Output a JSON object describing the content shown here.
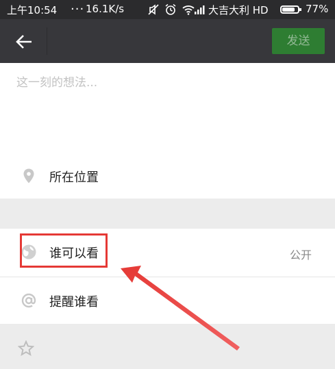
{
  "status_bar": {
    "time": "上午10:54",
    "dots": "...",
    "speed": "16.1K/s",
    "carrier": "大吉大利 HD",
    "battery": "77%",
    "icons": [
      "mute-icon",
      "alarm-icon",
      "wifi-icon",
      "signal-icon",
      "battery-icon"
    ]
  },
  "toolbar": {
    "back_icon": "arrow-left-icon",
    "send_label": "发送"
  },
  "compose": {
    "placeholder": "这一刻的想法..."
  },
  "options": {
    "location_label": "所在位置",
    "visibility_label": "谁可以看",
    "visibility_value": "公开",
    "remind_label": "提醒谁看"
  },
  "colors": {
    "toolbar_bg": "#37373b",
    "send_bg": "#2e7d32",
    "highlight": "#e53935"
  }
}
